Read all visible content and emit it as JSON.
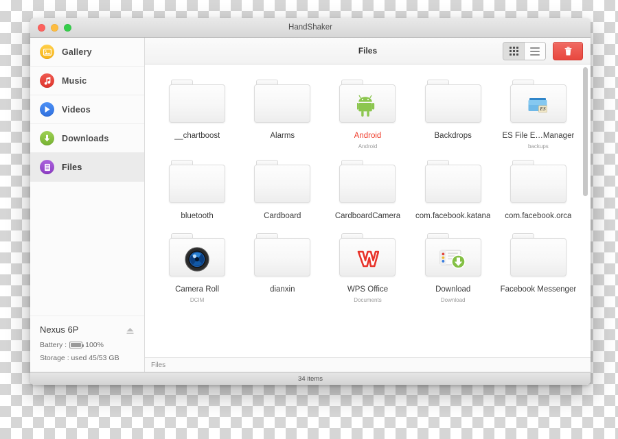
{
  "window": {
    "title": "HandShaker",
    "traffic_lights": [
      "close",
      "minimize",
      "zoom"
    ]
  },
  "sidebar": {
    "items": [
      {
        "label": "Gallery",
        "icon": "gallery-icon",
        "color": "#fdc02f",
        "active": false
      },
      {
        "label": "Music",
        "icon": "music-icon",
        "color": "#e8453c",
        "active": false
      },
      {
        "label": "Videos",
        "icon": "videos-icon",
        "color": "#3b82f0",
        "active": false
      },
      {
        "label": "Downloads",
        "icon": "downloads-icon",
        "color": "#8bc34a",
        "active": false
      },
      {
        "label": "Files",
        "icon": "files-icon",
        "color": "#9b4fd1",
        "active": true
      }
    ],
    "device": {
      "name": "Nexus 6P",
      "eject_icon": "eject-icon",
      "battery_label": "Battery :",
      "battery_value": "100%",
      "storage_text": "Storage : used 45/53 GB"
    }
  },
  "toolbar": {
    "title": "Files",
    "grid_view_icon": "grid-view-icon",
    "list_view_icon": "list-view-icon",
    "delete_icon": "trash-icon",
    "active_view": "grid"
  },
  "content": {
    "items": [
      {
        "name": "__chartboost",
        "subtitle": "",
        "icon": "plain-folder",
        "highlighted": false
      },
      {
        "name": "Alarms",
        "subtitle": "",
        "icon": "plain-folder",
        "highlighted": false
      },
      {
        "name": "Android",
        "subtitle": "Android",
        "icon": "android-folder",
        "highlighted": true
      },
      {
        "name": "Backdrops",
        "subtitle": "",
        "icon": "plain-folder",
        "highlighted": false
      },
      {
        "name": "ES File E…Manager",
        "subtitle": "backups",
        "icon": "es-folder",
        "highlighted": false
      },
      {
        "name": "bluetooth",
        "subtitle": "",
        "icon": "plain-folder",
        "highlighted": false
      },
      {
        "name": "Cardboard",
        "subtitle": "",
        "icon": "plain-folder",
        "highlighted": false
      },
      {
        "name": "CardboardCamera",
        "subtitle": "",
        "icon": "plain-folder",
        "highlighted": false
      },
      {
        "name": "com.facebook.katana",
        "subtitle": "",
        "icon": "plain-folder",
        "highlighted": false
      },
      {
        "name": "com.facebook.orca",
        "subtitle": "",
        "icon": "plain-folder",
        "highlighted": false
      },
      {
        "name": "Camera Roll",
        "subtitle": "DCIM",
        "icon": "camera-folder",
        "highlighted": false
      },
      {
        "name": "dianxin",
        "subtitle": "",
        "icon": "plain-folder",
        "highlighted": false
      },
      {
        "name": "WPS Office",
        "subtitle": "Documents",
        "icon": "wps-folder",
        "highlighted": false
      },
      {
        "name": "Download",
        "subtitle": "Download",
        "icon": "download-folder",
        "highlighted": false
      },
      {
        "name": "Facebook Messenger",
        "subtitle": "",
        "icon": "plain-folder",
        "highlighted": false
      }
    ]
  },
  "pathbar": {
    "text": "Files"
  },
  "statusbar": {
    "text": "34 items"
  },
  "colors": {
    "highlight_text": "#ef3c2a",
    "trash_red": "#e8483f",
    "selected_row": "#ebebeb"
  }
}
